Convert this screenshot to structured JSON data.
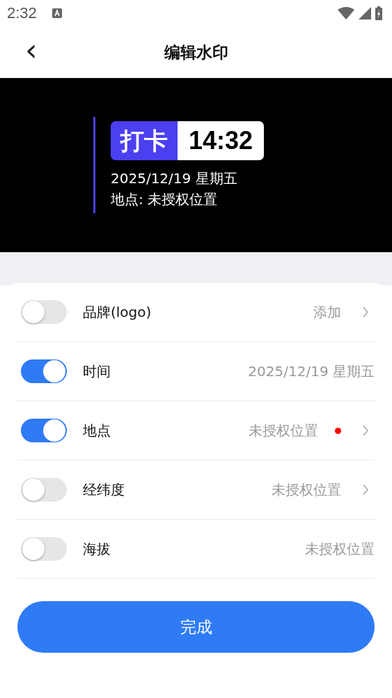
{
  "status_bar": {
    "time": "2:32"
  },
  "header": {
    "back": "‹",
    "title": "编辑水印"
  },
  "preview": {
    "tag": "打卡",
    "time": "14:32",
    "date": "2025/12/19 星期五",
    "location": "地点: 未授权位置"
  },
  "settings": [
    {
      "label": "品牌(logo)",
      "on": false,
      "value": "添加",
      "dot": false,
      "chevron": true
    },
    {
      "label": "时间",
      "on": true,
      "value": "2025/12/19 星期五",
      "dot": false,
      "chevron": false
    },
    {
      "label": "地点",
      "on": true,
      "value": "未授权位置",
      "dot": true,
      "chevron": true
    },
    {
      "label": "经纬度",
      "on": false,
      "value": "未授权位置",
      "dot": false,
      "chevron": true
    },
    {
      "label": "海拔",
      "on": false,
      "value": "未授权位置",
      "dot": false,
      "chevron": false
    }
  ],
  "done_button": "完成"
}
